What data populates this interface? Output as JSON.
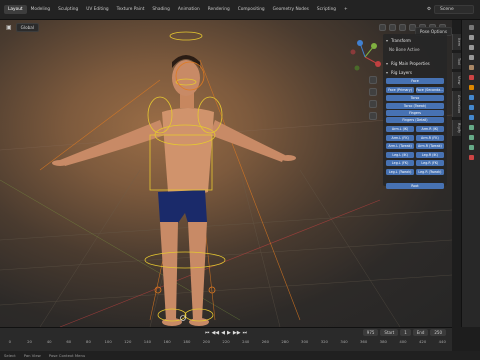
{
  "topbar": {
    "workspace_tabs": [
      "Layout",
      "Modeling",
      "Sculpting",
      "UV Editing",
      "Texture Paint",
      "Shading",
      "Animation",
      "Rendering",
      "Compositing",
      "Geometry Nodes",
      "Scripting",
      "+"
    ],
    "active_index": 0,
    "scene_label": "Scene"
  },
  "viewport": {
    "mode_label": "Global",
    "pose_options": "Pose Options"
  },
  "npanel": {
    "transform_header": "Transform",
    "no_bone": "No Bone Active",
    "rig_main_header": "Rig Main Properties",
    "rig_layers_header": "Rig Layers",
    "layers": [
      [
        "Face"
      ],
      [
        "Face (Primary)",
        "Face (Seconda..."
      ],
      [
        "Torso"
      ],
      [
        "Torso (Tweak)"
      ],
      [
        "Fingers"
      ],
      [
        "Fingers (Detail)"
      ],
      [
        "Arm.L (IK)",
        "Arm.R (IK)"
      ],
      [
        "Arm.L (FK)",
        "Arm.R (FK)"
      ],
      [
        "Arm.L (Tweak)",
        "Arm.R (Tweak)"
      ],
      [
        "Leg.L (IK)",
        "Leg.R (IK)"
      ],
      [
        "Leg.L (FK)",
        "Leg.R (FK)"
      ],
      [
        "Leg.L (Tweak)",
        "Leg.R (Tweak)"
      ]
    ],
    "root_label": "Root"
  },
  "side_tabs": [
    "Item",
    "Tool",
    "View",
    "Animation",
    "Rigify"
  ],
  "timeline": {
    "current_frame": "975",
    "start_label": "Start",
    "start_value": "1",
    "end_label": "End",
    "end_value": "250",
    "ruler": [
      "0",
      "20",
      "40",
      "60",
      "80",
      "100",
      "120",
      "140",
      "160",
      "180",
      "200",
      "220",
      "240",
      "260",
      "280",
      "300",
      "320",
      "340",
      "360",
      "380",
      "400",
      "420",
      "440"
    ]
  },
  "status": [
    "Select",
    "Pan View",
    "Pose Context Menu"
  ],
  "colors": {
    "accent": "#4772b3",
    "bone_yellow": "#e6c830",
    "bone_orange": "#e07a20"
  }
}
